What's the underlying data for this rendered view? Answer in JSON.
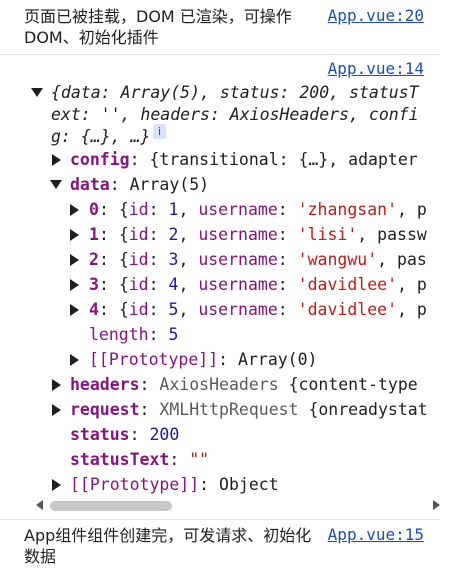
{
  "messages": {
    "first": {
      "text": "页面已被挂载，DOM 已渲染，可操作 DOM、初始化插件",
      "source": "App.vue:20"
    },
    "object_log": {
      "source": "App.vue:14"
    },
    "last": {
      "text": "App组件组件创建完，可发请求、初始化数据",
      "source": "App.vue:15"
    }
  },
  "preview": {
    "line1": "{data: Array(5), status: 200, statusT",
    "line2": "ext: '', headers: AxiosHeaders, confi",
    "line3": "g: {…}, …}",
    "info_glyph": "i"
  },
  "tree": {
    "config": {
      "key": "config",
      "value": "{transitional: {…}, adapter"
    },
    "data": {
      "key": "data",
      "value": "Array(5)"
    },
    "rows": [
      {
        "index": "0",
        "id": "1",
        "username": "'zhangsan'",
        "tail": ", p"
      },
      {
        "index": "1",
        "id": "2",
        "username": "'lisi'",
        "tail": ", passw"
      },
      {
        "index": "2",
        "id": "3",
        "username": "'wangwu'",
        "tail": ", pas"
      },
      {
        "index": "3",
        "id": "4",
        "username": "'davidlee'",
        "tail": ", p"
      },
      {
        "index": "4",
        "id": "5",
        "username": "'davidlee'",
        "tail": ", p"
      }
    ],
    "length": {
      "key": "length",
      "value": "5"
    },
    "data_proto": {
      "key": "[[Prototype]]",
      "value": "Array(0)"
    },
    "headers": {
      "key": "headers",
      "type": "AxiosHeaders",
      "value": "{content-type"
    },
    "request": {
      "key": "request",
      "type": "XMLHttpRequest",
      "value": "{onreadystat"
    },
    "status": {
      "key": "status",
      "value": "200"
    },
    "statusText": {
      "key": "statusText",
      "value": "\"\""
    },
    "proto": {
      "key": "[[Prototype]]",
      "value": "Object"
    }
  },
  "labels": {
    "colon": ": ",
    "id_key": "id",
    "username_key": "username",
    "open_brace": "{",
    "comma": ", "
  }
}
